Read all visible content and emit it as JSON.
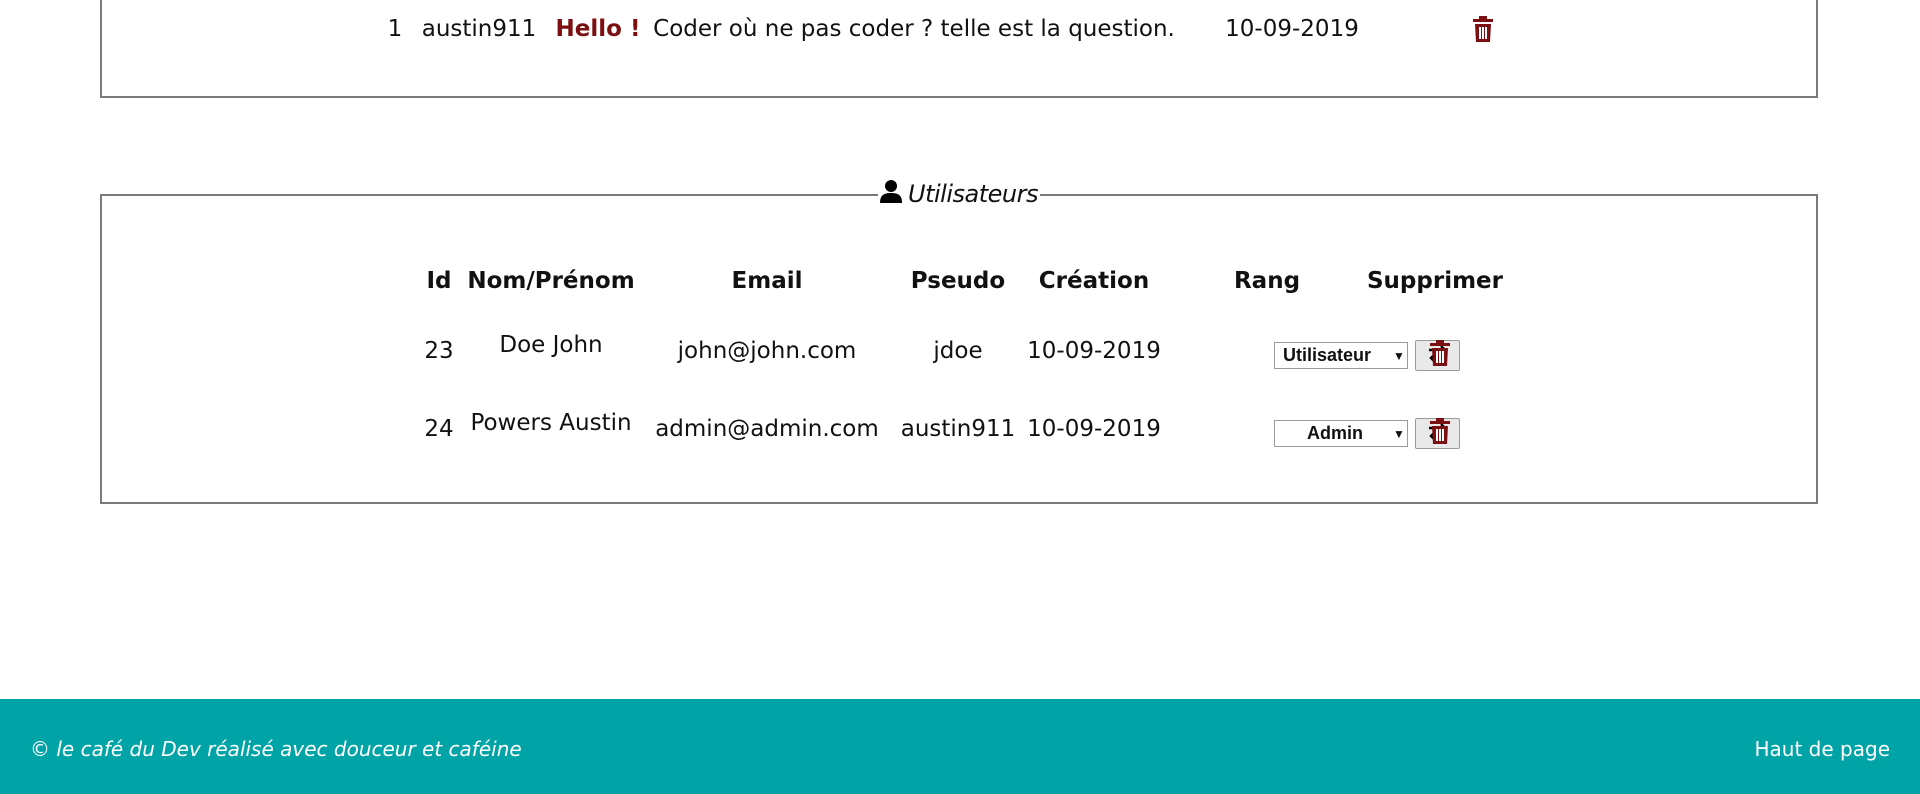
{
  "messages": {
    "rows": [
      {
        "id": "1",
        "pseudo": "austin911",
        "title": "Hello !",
        "content": "Coder où ne pas coder ? telle est la question.",
        "date": "10-09-2019",
        "delete_icon": "trash-icon"
      }
    ]
  },
  "users": {
    "legend": "Utilisateurs",
    "legend_icon": "user-icon",
    "headers": [
      "Id",
      "Nom/Prénom",
      "Email",
      "Pseudo",
      "Création",
      "Rang",
      "Supprimer"
    ],
    "rows": [
      {
        "id": "23",
        "name": "Doe John",
        "email": "john@john.com",
        "pseudo": "jdoe",
        "created": "10-09-2019",
        "rank": "Utilisateur"
      },
      {
        "id": "24",
        "name": "Powers Austin",
        "email": "admin@admin.com",
        "pseudo": "austin911",
        "created": "10-09-2019",
        "rank": "Admin"
      }
    ],
    "swap_icon": "swap-arrows-icon",
    "delete_icon": "trash-icon"
  },
  "colors": {
    "footer_bg": "#00a3a6",
    "danger": "#7b0f12",
    "border": "#7a7a7a"
  },
  "footer": {
    "copyright": "© le café du Dev réalisé avec douceur et caféine",
    "top_link": "Haut de page"
  }
}
